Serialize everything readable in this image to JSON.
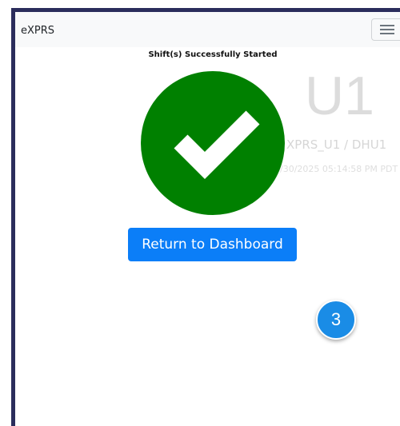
{
  "app": {
    "brand": "eXPRS"
  },
  "navbar": {
    "menu_icon": "hamburger-menu-icon"
  },
  "message": {
    "title": "Shift(s) Successfully Started",
    "status_icon": "check-circle-icon",
    "status_color": "#008000"
  },
  "unit": {
    "code": "U1",
    "assignment": "XPRS_U1 / DHU1",
    "timestamp": "5/30/2025 05:14:58 PM PDT"
  },
  "actions": {
    "return_label": "Return to Dashboard",
    "button_color": "#0b7ef8"
  },
  "annotation": {
    "step_number": "3",
    "badge_color": "#1a8ce6"
  }
}
